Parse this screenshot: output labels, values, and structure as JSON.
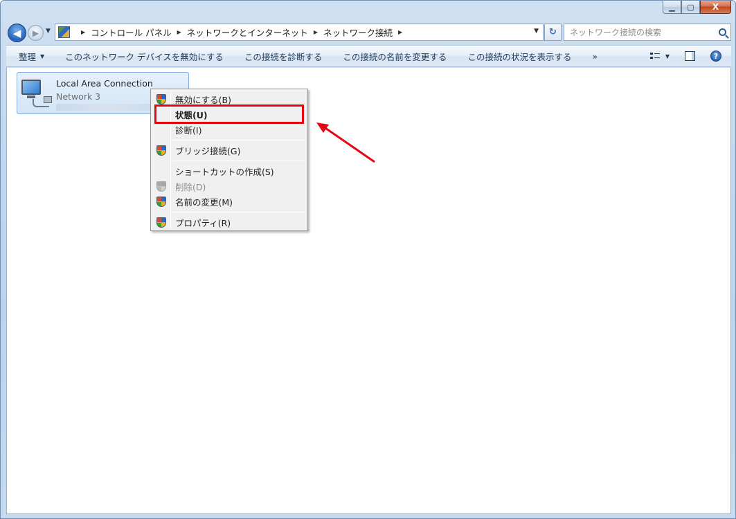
{
  "window": {
    "caption_buttons": {
      "minimize": "▁",
      "maximize": "▢",
      "close": "X"
    }
  },
  "nav": {
    "back": "◀",
    "forward": "▶",
    "recent": "▼",
    "breadcrumbs": [
      "コントロール パネル",
      "ネットワークとインターネット",
      "ネットワーク接続"
    ],
    "refresh": "↻",
    "search_placeholder": "ネットワーク接続の検索"
  },
  "commandbar": {
    "organize": "整理",
    "items": [
      "このネットワーク デバイスを無効にする",
      "この接続を診断する",
      "この接続の名前を変更する",
      "この接続の状況を表示する"
    ],
    "more": "»",
    "help": "?"
  },
  "connection": {
    "name": "Local Area Connection",
    "network": "Network  3"
  },
  "context_menu": {
    "items": [
      {
        "label": "無効にする(B)",
        "icon": "uac-shield-icon"
      },
      {
        "label": "状態(U)",
        "bold": true
      },
      {
        "label": "診断(I)"
      },
      {
        "label": "ブリッジ接続(G)",
        "icon": "uac-shield-icon"
      },
      {
        "label": "ショートカットの作成(S)"
      },
      {
        "label": "削除(D)",
        "icon": "uac-shield-icon",
        "disabled": true
      },
      {
        "label": "名前の変更(M)",
        "icon": "uac-shield-icon"
      },
      {
        "label": "プロパティ(R)",
        "icon": "uac-shield-icon"
      }
    ]
  },
  "annotation": {
    "highlight_color": "#e30613",
    "arrow_color": "#e30613"
  }
}
